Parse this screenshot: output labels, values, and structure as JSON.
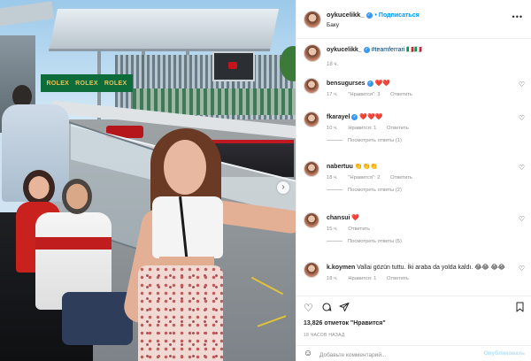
{
  "photo": {
    "billboard_words": [
      "ROLEX",
      "ROLEX",
      "ROLEX"
    ],
    "next_icon": "chevron-right-icon"
  },
  "post": {
    "author": "oykucelikk_",
    "follow_label": "• Подписаться",
    "location": "Баку",
    "more_icon": "more-horizontal-icon"
  },
  "caption": {
    "author": "oykucelikk_",
    "text": "#teamferrari 🇮🇹🇮🇹",
    "time": "18 ч."
  },
  "comments": [
    {
      "user": "bensugurses",
      "verified": true,
      "text": "❤️❤️",
      "time": "17 ч.",
      "likes": "\"Нравится\": 3",
      "reply": "Ответить",
      "replies": ""
    },
    {
      "user": "fkarayel",
      "verified": true,
      "text": "❤️❤️❤️",
      "time": "10 ч.",
      "likes": "Нравится: 1",
      "reply": "Ответить",
      "replies": "Посмотреть ответы (1)"
    },
    {
      "user": "nabertuu",
      "verified": false,
      "text": "👏👏👏",
      "time": "18 ч.",
      "likes": "\"Нравится\": 2",
      "reply": "Ответить",
      "replies": "Посмотреть ответы (2)"
    },
    {
      "user": "chansui",
      "verified": false,
      "text": "❤️",
      "time": "15 ч.",
      "likes": "",
      "reply": "Ответить",
      "replies": "Посмотреть ответы (5)"
    },
    {
      "user": "k.koymen",
      "verified": false,
      "text": "Vallai gözün tuttu. İki araba da yolda kaldı. 😂😂 😂😂",
      "time": "18 ч.",
      "likes": "Нравится: 1",
      "reply": "Ответить",
      "replies": ""
    }
  ],
  "actions": {
    "like_icon": "heart-icon",
    "comment_icon": "comment-icon",
    "share_icon": "send-icon",
    "save_icon": "bookmark-icon"
  },
  "likes_text": "13,826 отметок \"Нравится\"",
  "posted_ago": "18 ЧАСОВ НАЗАД",
  "composer": {
    "emoji_icon": "smiley-icon",
    "placeholder": "Добавьте комментарий...",
    "publish_label": "Опубликовать"
  },
  "colors": {
    "link_blue": "#0095f6",
    "verified_blue": "#3897f0",
    "muted_text": "#8e8e8e",
    "publish_disabled": "#b2dffc"
  }
}
